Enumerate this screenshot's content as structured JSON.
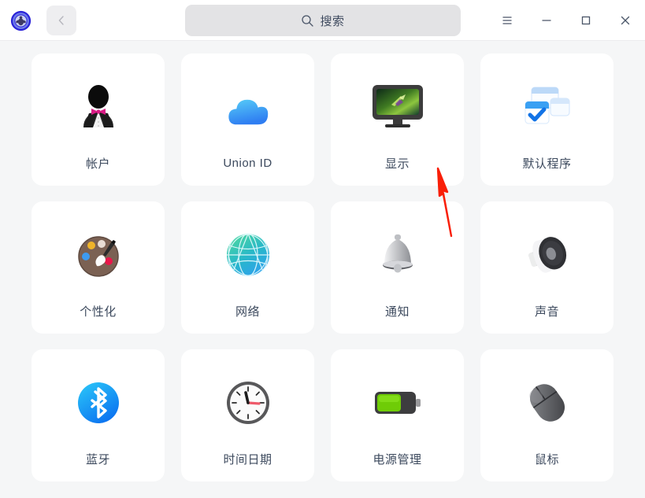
{
  "window": {
    "app_logo_icon": "gear-logo-icon",
    "back_label": "‹",
    "back_icon": "chevron-left-icon",
    "controls": [
      {
        "name": "menu",
        "icon": "hamburger-menu-icon",
        "label": "☰"
      },
      {
        "name": "minimize",
        "icon": "minimize-icon",
        "label": "—"
      },
      {
        "name": "maximize",
        "icon": "maximize-icon",
        "label": "□"
      },
      {
        "name": "close",
        "icon": "close-icon",
        "label": "✕"
      }
    ]
  },
  "search": {
    "icon": "search-icon",
    "placeholder": "搜索",
    "value": ""
  },
  "settings_grid": {
    "items": [
      {
        "label": "帐户",
        "icon": "user-account-icon"
      },
      {
        "label": "Union ID",
        "icon": "cloud-icon"
      },
      {
        "label": "显示",
        "icon": "monitor-display-icon"
      },
      {
        "label": "默认程序",
        "icon": "default-programs-icon"
      },
      {
        "label": "个性化",
        "icon": "paint-palette-icon"
      },
      {
        "label": "网络",
        "icon": "globe-network-icon"
      },
      {
        "label": "通知",
        "icon": "bell-notification-icon"
      },
      {
        "label": "声音",
        "icon": "speaker-sound-icon"
      },
      {
        "label": "蓝牙",
        "icon": "bluetooth-icon"
      },
      {
        "label": "时间日期",
        "icon": "clock-icon"
      },
      {
        "label": "电源管理",
        "icon": "battery-power-icon"
      },
      {
        "label": "鼠标",
        "icon": "mouse-icon"
      }
    ]
  },
  "annotation": {
    "arrow_color": "#f91f08",
    "arrow_name": "red-pointer-arrow"
  },
  "colors": {
    "background": "#f5f6f7",
    "tile": "#ffffff",
    "label_text": "#3d4a5e",
    "searchbar": "#e3e3e5"
  }
}
